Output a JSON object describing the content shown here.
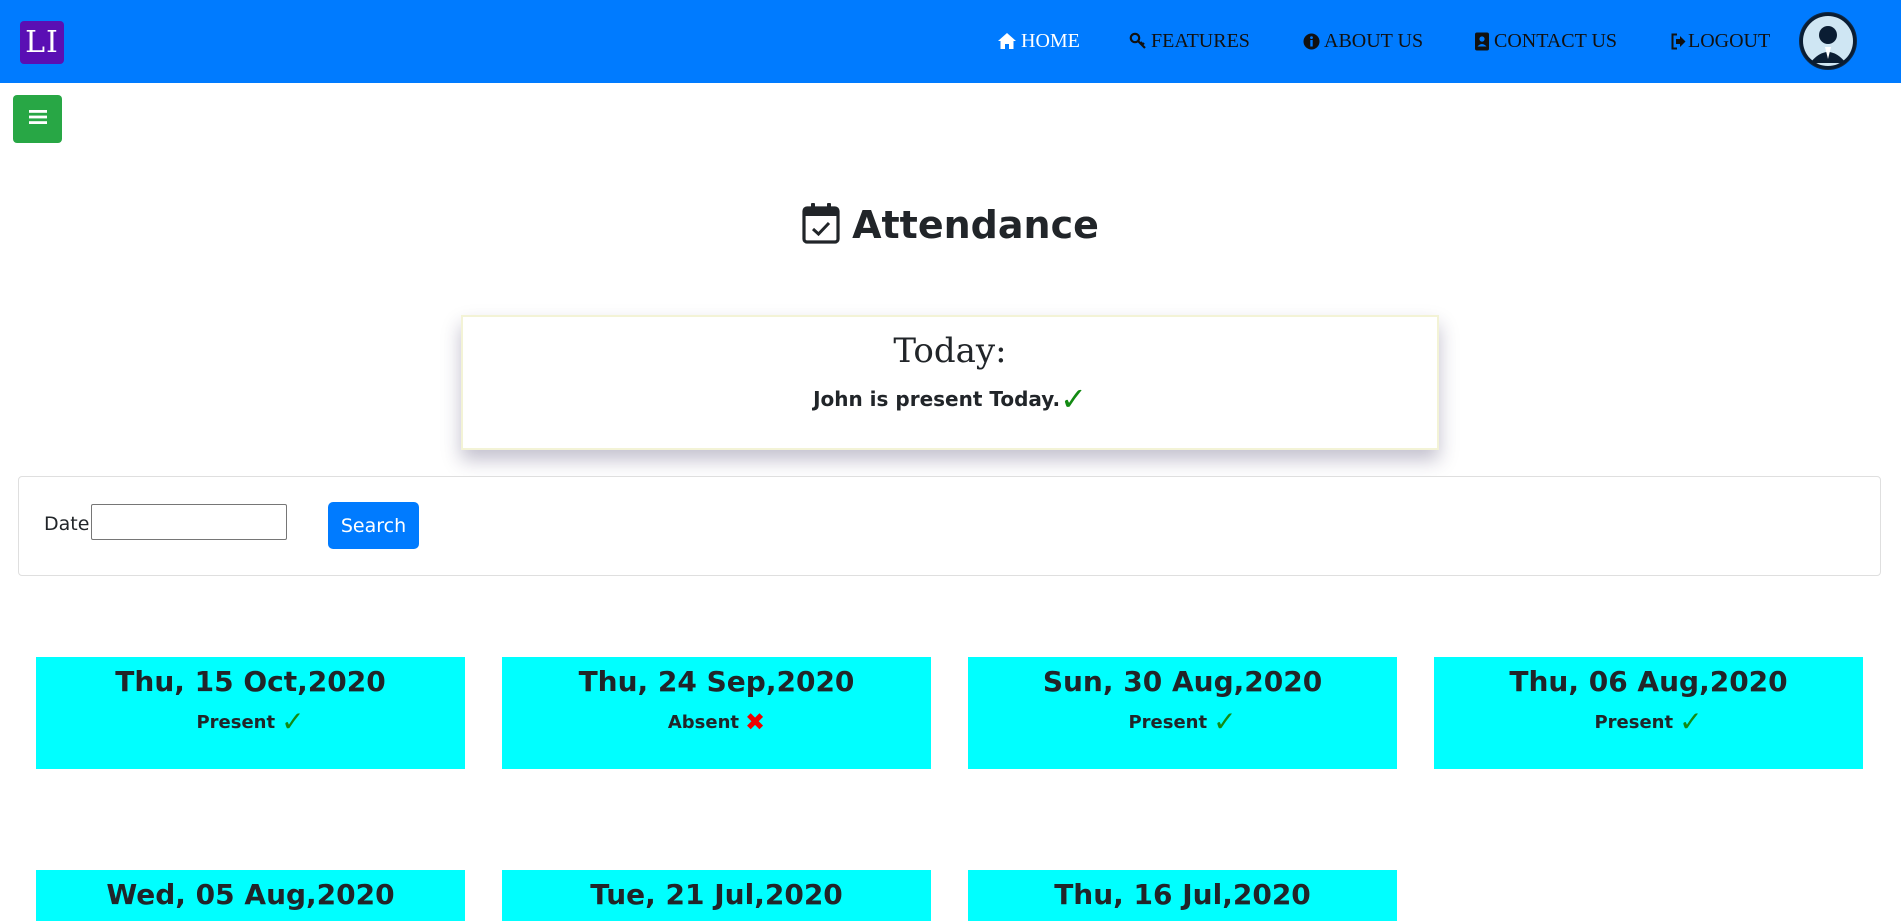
{
  "logo": {
    "text": "LI"
  },
  "nav": {
    "items": [
      {
        "label": "HOME",
        "icon": "home-icon"
      },
      {
        "label": "FEATURES",
        "icon": "key-icon"
      },
      {
        "label": "ABOUT US",
        "icon": "info-icon"
      },
      {
        "label": "CONTACT US",
        "icon": "address-book-icon"
      },
      {
        "label": "LOGOUT",
        "icon": "logout-icon"
      }
    ]
  },
  "sidebar_toggle": {
    "icon": "menu-icon"
  },
  "page": {
    "title": "Attendance",
    "icon": "calendar-check-icon"
  },
  "today": {
    "title": "Today:",
    "message": "John is present Today.",
    "mark": "✓"
  },
  "search": {
    "date_label": "Date",
    "date_value": "",
    "button_label": "Search"
  },
  "records": [
    {
      "date": "Thu, 15 Oct,2020",
      "status": "Present",
      "mark": "✓"
    },
    {
      "date": "Thu, 24 Sep,2020",
      "status": "Absent",
      "mark": "✖"
    },
    {
      "date": "Sun, 30 Aug,2020",
      "status": "Present",
      "mark": "✓"
    },
    {
      "date": "Thu, 06 Aug,2020",
      "status": "Present",
      "mark": "✓"
    },
    {
      "date": "Wed, 05 Aug,2020",
      "status": "",
      "mark": ""
    },
    {
      "date": "Tue, 21 Jul,2020",
      "status": "",
      "mark": ""
    },
    {
      "date": "Thu, 16 Jul,2020",
      "status": "",
      "mark": ""
    }
  ],
  "colors": {
    "navbar": "#007bff",
    "logo": "#5a0fb4",
    "toggle": "#28a745",
    "card": "#00ffff",
    "present": "#138a13",
    "absent": "#ee0000"
  }
}
